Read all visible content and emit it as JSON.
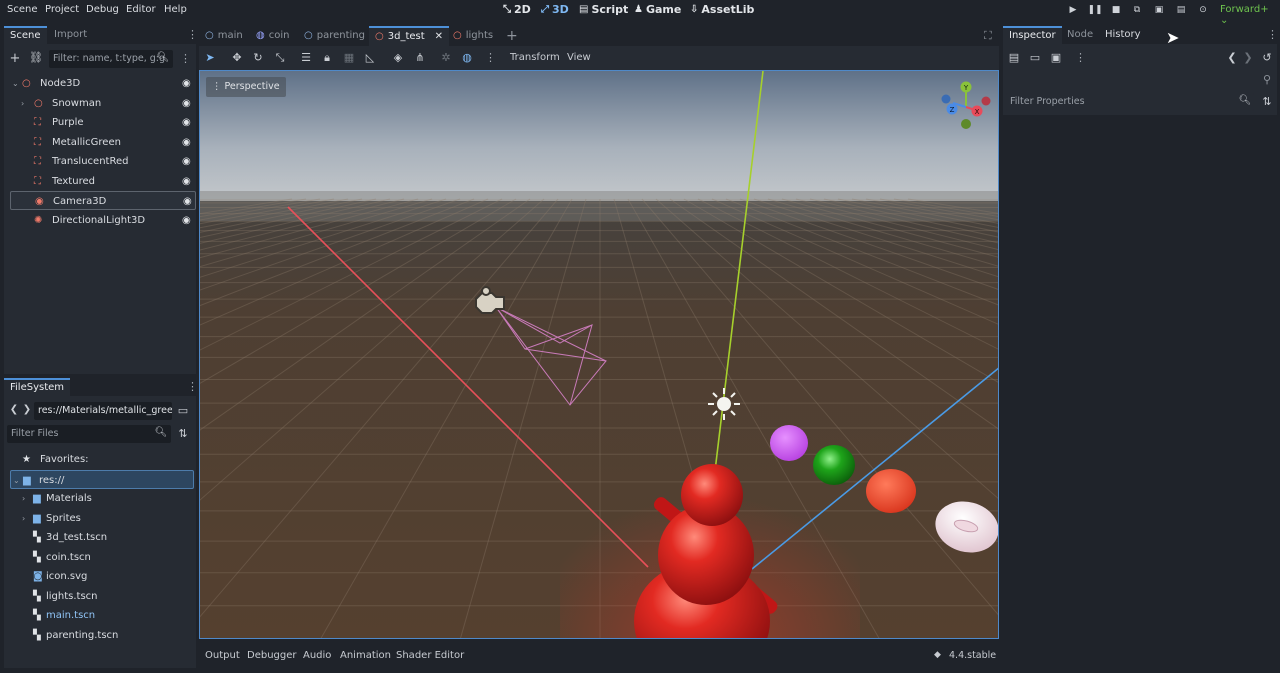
{
  "menu": [
    "Scene",
    "Project",
    "Debug",
    "Editor",
    "Help"
  ],
  "workspaces": [
    {
      "icon": "canvas-2d-icon",
      "glyph": "⤡",
      "label": "2D"
    },
    {
      "icon": "canvas-3d-icon",
      "glyph": "⤢",
      "label": "3D"
    },
    {
      "icon": "script-icon",
      "glyph": "▤",
      "label": "Script"
    },
    {
      "icon": "game-icon",
      "glyph": "♟",
      "label": "Game"
    },
    {
      "icon": "assetlib-icon",
      "glyph": "⇩",
      "label": "AssetLib"
    }
  ],
  "renderer": "Forward+",
  "scene_dock": {
    "tabs": [
      "Scene",
      "Import"
    ],
    "filter_placeholder": "Filter: name, t:type, g:g",
    "nodes": [
      {
        "label": "Node3D",
        "icon": "node3d-icon",
        "glyph": "○",
        "color": "#f07a6a"
      },
      {
        "label": "Snowman",
        "icon": "node3d-icon",
        "glyph": "○",
        "color": "#f07a6a"
      },
      {
        "label": "Purple",
        "icon": "mesh-instance-icon",
        "glyph": "⛶",
        "color": "#f07a6a"
      },
      {
        "label": "MetallicGreen",
        "icon": "mesh-instance-icon",
        "glyph": "⛶",
        "color": "#f07a6a"
      },
      {
        "label": "TranslucentRed",
        "icon": "mesh-instance-icon",
        "glyph": "⛶",
        "color": "#f07a6a"
      },
      {
        "label": "Textured",
        "icon": "mesh-instance-icon",
        "glyph": "⛶",
        "color": "#f07a6a"
      },
      {
        "label": "Camera3D",
        "icon": "camera-icon",
        "glyph": "◉",
        "color": "#f07a6a"
      },
      {
        "label": "DirectionalLight3D",
        "icon": "light-icon",
        "glyph": "✺",
        "color": "#f07a6a"
      }
    ]
  },
  "filesystem": {
    "tab": "FileSystem",
    "path": "res://Materials/metallic_gree",
    "filter_placeholder": "Filter Files",
    "favorites": "Favorites:",
    "root": "res://",
    "items": [
      {
        "label": "Materials",
        "type": "folder"
      },
      {
        "label": "Sprites",
        "type": "folder"
      },
      {
        "label": "3d_test.tscn",
        "type": "scene"
      },
      {
        "label": "coin.tscn",
        "type": "scene"
      },
      {
        "label": "icon.svg",
        "type": "image"
      },
      {
        "label": "lights.tscn",
        "type": "scene"
      },
      {
        "label": "main.tscn",
        "type": "scene"
      },
      {
        "label": "parenting.tscn",
        "type": "scene"
      }
    ]
  },
  "scene_tabs": [
    {
      "label": "main",
      "glyph": "○",
      "color": "#8fb3e0"
    },
    {
      "label": "coin",
      "glyph": "◍",
      "color": "#9aa6ff"
    },
    {
      "label": "parenting",
      "glyph": "○",
      "color": "#8fb3e0"
    },
    {
      "label": "3d_test",
      "glyph": "○",
      "color": "#f07a6a"
    },
    {
      "label": "lights",
      "glyph": "○",
      "color": "#f07a6a"
    }
  ],
  "viewport": {
    "menus": [
      "Transform",
      "View"
    ],
    "perspective": "Perspective",
    "gizmo": {
      "y": "Y",
      "x": "X",
      "z": "Z"
    }
  },
  "inspector": {
    "tabs": [
      "Inspector",
      "Node",
      "History"
    ],
    "filter_placeholder": "Filter Properties"
  },
  "bottom_tabs": [
    "Output",
    "Debugger",
    "Audio",
    "Animation",
    "Shader Editor"
  ],
  "version": "4.4.stable"
}
